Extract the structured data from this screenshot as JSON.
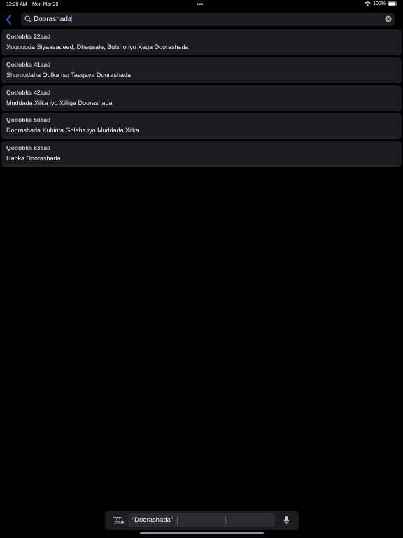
{
  "status_bar": {
    "time": "12:20 AM",
    "date": "Mon Mar 28",
    "dots": "•••",
    "battery": "100%"
  },
  "search": {
    "query": "Doorashada",
    "back_icon": "chevron-left-icon",
    "search_icon": "magnifier-icon",
    "clear_icon": "clear-x-circle-icon"
  },
  "results": [
    {
      "title": "Qodobka 22aad",
      "subtitle": "Xuquuqda Siyaasadeed, Dhaqaale, Bulsho iyo Xaqa Doorashada"
    },
    {
      "title": "Qodobka 41aad",
      "subtitle": "Shuruudaha Qofka Isu Taagaya Doorashada"
    },
    {
      "title": "Qodobka 42aad",
      "subtitle": "Muddada Xilka iyo Xilliga Doorashada"
    },
    {
      "title": "Qodobka 58aad",
      "subtitle": "Doorashada Xubinta Golaha iyo Muddada Xilka"
    },
    {
      "title": "Qodobka 83aad",
      "subtitle": "Habka Doorashada"
    }
  ],
  "shortcut_bar": {
    "suggestion": "“Doorashada”",
    "keyboard_icon": "keyboard-dismiss-icon",
    "mic_icon": "microphone-icon"
  },
  "colors": {
    "background": "#000000",
    "row_background": "#1c1c1e",
    "accent": "#0a84ff"
  }
}
